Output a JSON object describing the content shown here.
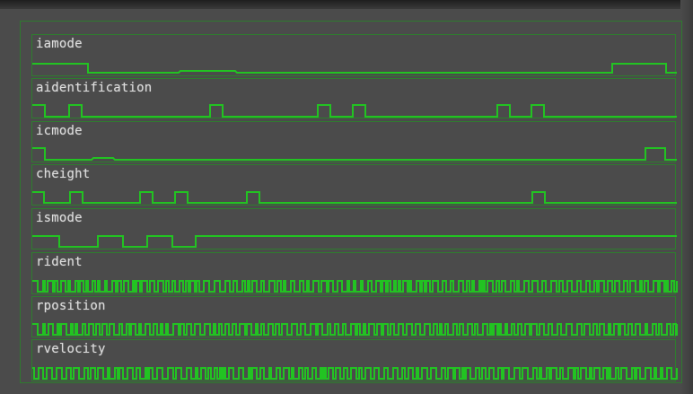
{
  "signals": [
    {
      "name": "iamode"
    },
    {
      "name": "aidentification"
    },
    {
      "name": "icmode"
    },
    {
      "name": "cheight"
    },
    {
      "name": "ismode"
    },
    {
      "name": "rident"
    },
    {
      "name": "rposition"
    },
    {
      "name": "rvelocity"
    }
  ],
  "colors": {
    "background": "#4b4b4b",
    "waveform": "#22c322",
    "row_border": "#2e7d2e",
    "label_text": "#dcdcdc"
  }
}
